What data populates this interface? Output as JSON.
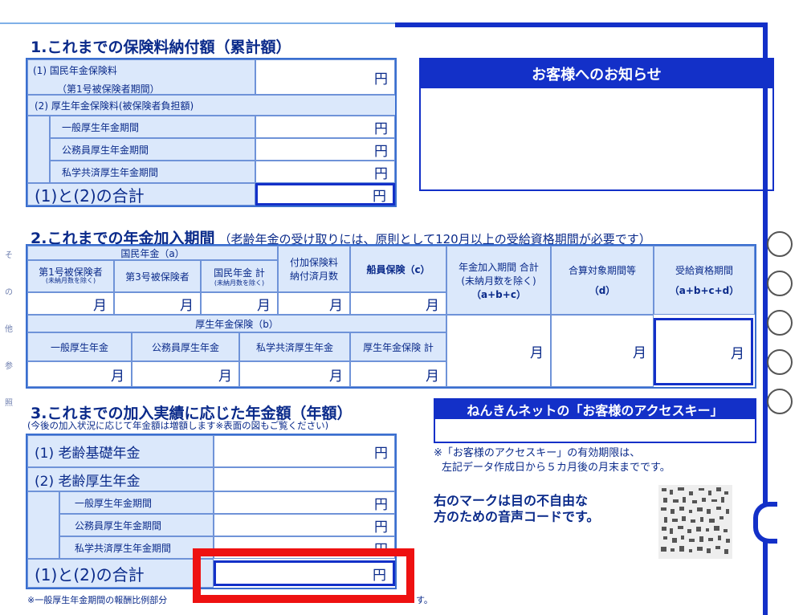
{
  "sec1": {
    "title": "1.これまでの保険料納付額（累計額）",
    "r1a": "(1) 国民年金保険料",
    "r1b": "（第1号被保険者期間）",
    "r2": "(2) 厚生年金保険料(被保険者負担額)",
    "r3": "一般厚生年金期間",
    "r4": "公務員厚生年金期間",
    "r5": "私学共済厚生年金期間",
    "r6": "(1)と(2)の合計",
    "yen": "円"
  },
  "notice": {
    "title": "お客様へのお知らせ"
  },
  "sec2": {
    "title": "2.これまでの年金加入期間",
    "note": "（老齢年金の受け取りには、原則として120月以上の受給資格期間が必要です）",
    "kokumin_a": "国民年金（a）",
    "h1a": "第1号被保険者",
    "h1b": "(未納月数を除く)",
    "h2": "第3号被保険者",
    "h3a": "国民年金 計",
    "h3b": "(未納月数を除く)",
    "h4a": "付加保険料",
    "h4b": "納付済月数",
    "h5": "船員保険（c）",
    "h6a": "年金加入期間 合計",
    "h6b": "(未納月数を除く)",
    "h6c": "（a+b+c）",
    "h7a": "合算対象期間等",
    "h7b": "（d）",
    "h8a": "受給資格期間",
    "h8b": "（a+b+c+d）",
    "kosei_b": "厚生年金保険（b）",
    "k1": "一般厚生年金",
    "k2": "公務員厚生年金",
    "k3": "私学共済厚生年金",
    "k4": "厚生年金保険 計",
    "tsuki": "月"
  },
  "sec3": {
    "title": "3.これまでの加入実績に応じた年金額（年額）",
    "note": "(今後の加入状況に応じて年金額は増額します※表面の図もご覧ください)",
    "r1": "(1) 老齢基礎年金",
    "r2": "(2) 老齢厚生年金",
    "r3": "一般厚生年金期間",
    "r4": "公務員厚生年金期間",
    "r5": "私学共済厚生年金期間",
    "r6": "(1)と(2)の合計",
    "footnote": "※一般厚生年金期間の報酬比例部分",
    "footnote_end": "す。"
  },
  "access": {
    "title": "ねんきんネットの「お客様のアクセスキー」",
    "note1": "※「お客様のアクセスキー」の有効期限は、",
    "note2": "左記データ作成日から５カ月後の月末までです。",
    "voice1": "右のマークは目の不自由な",
    "voice2": "方のための音声コードです。"
  },
  "left_margin_chars": [
    "そ",
    "の",
    "他",
    "参",
    "照"
  ],
  "colors": {
    "accent": "#1330c8",
    "light_cell": "#dbe8fb",
    "highlight": "#ee1111"
  }
}
